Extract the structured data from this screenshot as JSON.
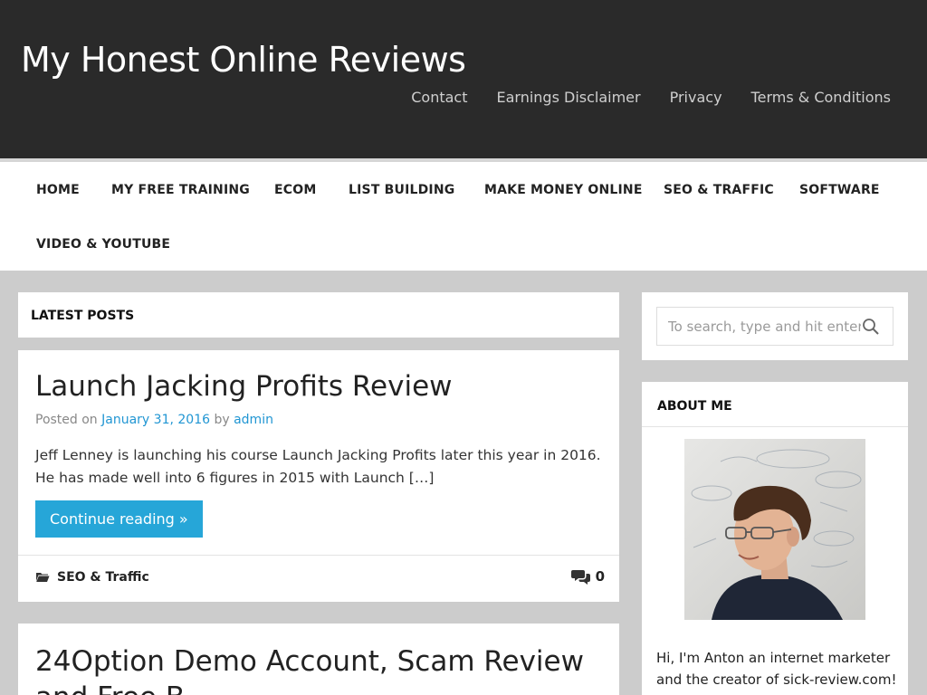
{
  "site": {
    "title": "My Honest Online Reviews"
  },
  "top_nav": [
    "Contact",
    "Earnings Disclaimer",
    "Privacy",
    "Terms & Conditions"
  ],
  "main_nav": [
    "HOME",
    "MY FREE TRAINING",
    "ECOM",
    "LIST BUILDING",
    "MAKE MONEY ONLINE",
    "SEO & TRAFFIC",
    "SOFTWARE",
    "VIDEO & YOUTUBE"
  ],
  "latest_posts_label": "LATEST POSTS",
  "post": {
    "title": "Launch Jacking Profits Review",
    "meta_posted_on": "Posted on",
    "meta_date": "January 31, 2016",
    "meta_by": "by",
    "meta_author": "admin",
    "excerpt": "Jeff Lenney is launching his course Launch Jacking Profits later this year in 2016. He has made well into 6 figures in 2015 with Launch […]",
    "continue_label": "Continue reading »",
    "category": "SEO & Traffic",
    "comment_count": "0"
  },
  "post2": {
    "title": "24Option Demo Account, Scam Review and Free B..."
  },
  "sidebar": {
    "search_placeholder": "To search, type and hit enter",
    "about_label": "ABOUT ME",
    "about_bio": "Hi, I'm Anton an internet marketer and the creator of sick-review.com! I"
  },
  "colors": {
    "header_bg": "#2a2a2a",
    "accent": "#26a6d8",
    "link": "#2196d3",
    "page_bg": "#cccccc"
  }
}
